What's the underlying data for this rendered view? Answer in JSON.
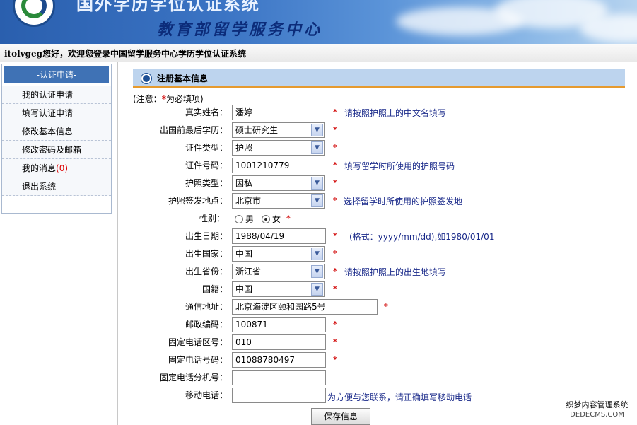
{
  "header": {
    "title_top": "国外学历学位认证系统",
    "title_sub": "教育部留学服务中心"
  },
  "welcome": "itolvgeg您好，欢迎您登录中国留学服务中心学历学位认证系统",
  "sidebar": {
    "heading": "-认证申请-",
    "items": [
      {
        "label": "我的认证申请"
      },
      {
        "label": "填写认证申请"
      },
      {
        "label": "修改基本信息"
      },
      {
        "label": "修改密码及邮箱"
      },
      {
        "label": "我的消息",
        "badge": "(0)"
      },
      {
        "label": "退出系统"
      }
    ]
  },
  "form": {
    "title": "注册基本信息",
    "note_prefix": "(注意：",
    "note_star": "*",
    "note_suffix": "为必填项)",
    "required_mark": "*",
    "fields": {
      "real_name": {
        "label": "真实姓名：",
        "value": "潘婷",
        "hint": "请按照护照上的中文名填写"
      },
      "education": {
        "label": "出国前最后学历：",
        "value": "硕士研究生"
      },
      "id_type": {
        "label": "证件类型：",
        "value": "护照"
      },
      "id_number": {
        "label": "证件号码：",
        "value": "1001210779",
        "hint": "填写留学时所使用的护照号码"
      },
      "passport_type": {
        "label": "护照类型：",
        "value": "因私"
      },
      "issue_place": {
        "label": "护照签发地点：",
        "value": "北京市",
        "hint": "选择留学时所使用的护照签发地"
      },
      "gender": {
        "label": "性别：",
        "option_male": "男",
        "option_female": "女",
        "selected": "女"
      },
      "birth_date": {
        "label": "出生日期：",
        "value": "1988/04/19",
        "hint": "(格式：yyyy/mm/dd),如1980/01/01"
      },
      "birth_country": {
        "label": "出生国家：",
        "value": "中国"
      },
      "birth_province": {
        "label": "出生省份：",
        "value": "浙江省",
        "hint": "请按照护照上的出生地填写"
      },
      "nationality": {
        "label": "国籍：",
        "value": "中国"
      },
      "address": {
        "label": "通信地址：",
        "value": "北京海淀区颐和园路5号"
      },
      "postal_code": {
        "label": "邮政编码：",
        "value": "100871"
      },
      "phone_area": {
        "label": "固定电话区号：",
        "value": "010"
      },
      "phone_number": {
        "label": "固定电话号码：",
        "value": "01088780497"
      },
      "phone_ext": {
        "label": "固定电话分机号：",
        "value": ""
      },
      "mobile": {
        "label": "移动电话：",
        "value": "",
        "hint": "为方便与您联系，请正确填写移动电话"
      }
    },
    "save_label": "保存信息"
  },
  "watermark": {
    "line1": "织梦内容管理系统",
    "line2": "DEDECMS.COM"
  }
}
